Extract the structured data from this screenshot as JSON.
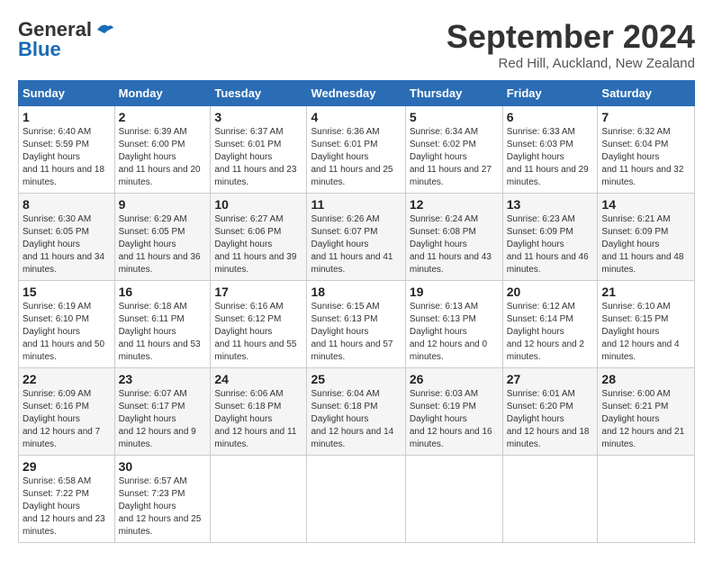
{
  "header": {
    "logo_general": "General",
    "logo_blue": "Blue",
    "month_year": "September 2024",
    "location": "Red Hill, Auckland, New Zealand"
  },
  "weekdays": [
    "Sunday",
    "Monday",
    "Tuesday",
    "Wednesday",
    "Thursday",
    "Friday",
    "Saturday"
  ],
  "weeks": [
    [
      {
        "day": "1",
        "sunrise": "6:40 AM",
        "sunset": "5:59 PM",
        "daylight": "11 hours and 18 minutes."
      },
      {
        "day": "2",
        "sunrise": "6:39 AM",
        "sunset": "6:00 PM",
        "daylight": "11 hours and 20 minutes."
      },
      {
        "day": "3",
        "sunrise": "6:37 AM",
        "sunset": "6:01 PM",
        "daylight": "11 hours and 23 minutes."
      },
      {
        "day": "4",
        "sunrise": "6:36 AM",
        "sunset": "6:01 PM",
        "daylight": "11 hours and 25 minutes."
      },
      {
        "day": "5",
        "sunrise": "6:34 AM",
        "sunset": "6:02 PM",
        "daylight": "11 hours and 27 minutes."
      },
      {
        "day": "6",
        "sunrise": "6:33 AM",
        "sunset": "6:03 PM",
        "daylight": "11 hours and 29 minutes."
      },
      {
        "day": "7",
        "sunrise": "6:32 AM",
        "sunset": "6:04 PM",
        "daylight": "11 hours and 32 minutes."
      }
    ],
    [
      {
        "day": "8",
        "sunrise": "6:30 AM",
        "sunset": "6:05 PM",
        "daylight": "11 hours and 34 minutes."
      },
      {
        "day": "9",
        "sunrise": "6:29 AM",
        "sunset": "6:05 PM",
        "daylight": "11 hours and 36 minutes."
      },
      {
        "day": "10",
        "sunrise": "6:27 AM",
        "sunset": "6:06 PM",
        "daylight": "11 hours and 39 minutes."
      },
      {
        "day": "11",
        "sunrise": "6:26 AM",
        "sunset": "6:07 PM",
        "daylight": "11 hours and 41 minutes."
      },
      {
        "day": "12",
        "sunrise": "6:24 AM",
        "sunset": "6:08 PM",
        "daylight": "11 hours and 43 minutes."
      },
      {
        "day": "13",
        "sunrise": "6:23 AM",
        "sunset": "6:09 PM",
        "daylight": "11 hours and 46 minutes."
      },
      {
        "day": "14",
        "sunrise": "6:21 AM",
        "sunset": "6:09 PM",
        "daylight": "11 hours and 48 minutes."
      }
    ],
    [
      {
        "day": "15",
        "sunrise": "6:19 AM",
        "sunset": "6:10 PM",
        "daylight": "11 hours and 50 minutes."
      },
      {
        "day": "16",
        "sunrise": "6:18 AM",
        "sunset": "6:11 PM",
        "daylight": "11 hours and 53 minutes."
      },
      {
        "day": "17",
        "sunrise": "6:16 AM",
        "sunset": "6:12 PM",
        "daylight": "11 hours and 55 minutes."
      },
      {
        "day": "18",
        "sunrise": "6:15 AM",
        "sunset": "6:13 PM",
        "daylight": "11 hours and 57 minutes."
      },
      {
        "day": "19",
        "sunrise": "6:13 AM",
        "sunset": "6:13 PM",
        "daylight": "12 hours and 0 minutes."
      },
      {
        "day": "20",
        "sunrise": "6:12 AM",
        "sunset": "6:14 PM",
        "daylight": "12 hours and 2 minutes."
      },
      {
        "day": "21",
        "sunrise": "6:10 AM",
        "sunset": "6:15 PM",
        "daylight": "12 hours and 4 minutes."
      }
    ],
    [
      {
        "day": "22",
        "sunrise": "6:09 AM",
        "sunset": "6:16 PM",
        "daylight": "12 hours and 7 minutes."
      },
      {
        "day": "23",
        "sunrise": "6:07 AM",
        "sunset": "6:17 PM",
        "daylight": "12 hours and 9 minutes."
      },
      {
        "day": "24",
        "sunrise": "6:06 AM",
        "sunset": "6:18 PM",
        "daylight": "12 hours and 11 minutes."
      },
      {
        "day": "25",
        "sunrise": "6:04 AM",
        "sunset": "6:18 PM",
        "daylight": "12 hours and 14 minutes."
      },
      {
        "day": "26",
        "sunrise": "6:03 AM",
        "sunset": "6:19 PM",
        "daylight": "12 hours and 16 minutes."
      },
      {
        "day": "27",
        "sunrise": "6:01 AM",
        "sunset": "6:20 PM",
        "daylight": "12 hours and 18 minutes."
      },
      {
        "day": "28",
        "sunrise": "6:00 AM",
        "sunset": "6:21 PM",
        "daylight": "12 hours and 21 minutes."
      }
    ],
    [
      {
        "day": "29",
        "sunrise": "6:58 AM",
        "sunset": "7:22 PM",
        "daylight": "12 hours and 23 minutes."
      },
      {
        "day": "30",
        "sunrise": "6:57 AM",
        "sunset": "7:23 PM",
        "daylight": "12 hours and 25 minutes."
      },
      null,
      null,
      null,
      null,
      null
    ]
  ]
}
